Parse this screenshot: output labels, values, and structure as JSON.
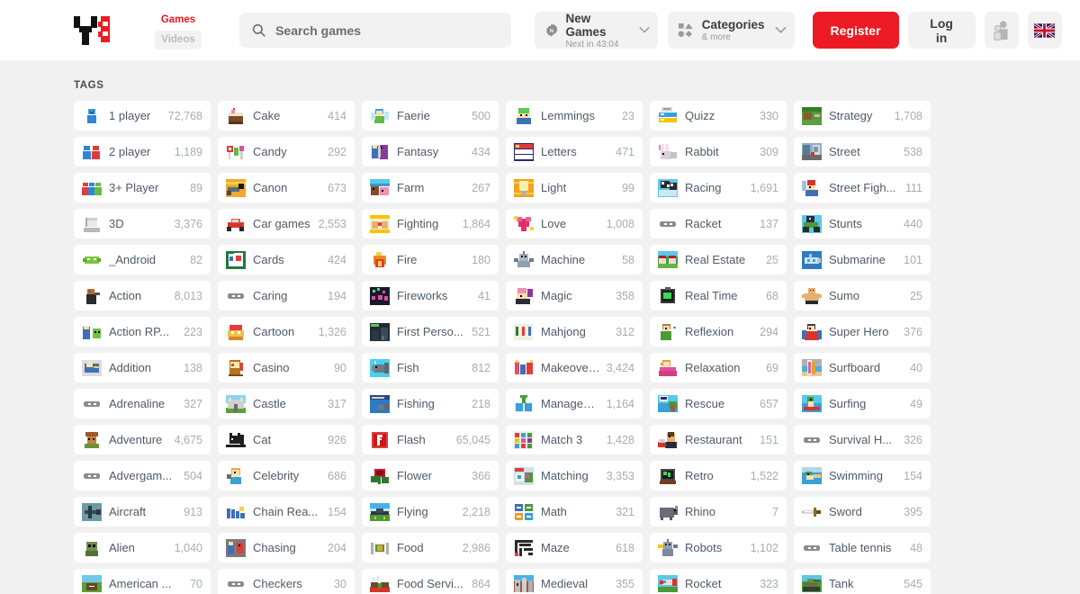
{
  "header": {
    "logo_name": "y8-logo",
    "mode_games": "Games",
    "mode_videos": "Videos",
    "search_placeholder": "Search games",
    "search_value": "",
    "new_games_title": "New Games",
    "new_games_sub": "Next in 43:04",
    "categories_title": "Categories",
    "categories_sub": "& more",
    "register_label": "Register",
    "login_label": "Log in",
    "avatar_icon": "user-silhouette-icon",
    "flag_icon": "uk-flag-icon",
    "brand_red": "#ec1b23",
    "chip_grey": "#f2f2f2"
  },
  "main": {
    "tags_heading": "TAGS",
    "columns": 6,
    "tags": [
      {
        "label": "1 player",
        "count": "72,768",
        "icon": "one-player-icon"
      },
      {
        "label": "Cake",
        "count": "414",
        "icon": "cake-icon"
      },
      {
        "label": "Faerie",
        "count": "500",
        "icon": "faerie-icon"
      },
      {
        "label": "Lemmings",
        "count": "23",
        "icon": "lemmings-icon"
      },
      {
        "label": "Quizz",
        "count": "330",
        "icon": "quizz-icon"
      },
      {
        "label": "Strategy",
        "count": "1,708",
        "icon": "strategy-icon"
      },
      {
        "label": "2 player",
        "count": "1,189",
        "icon": "two-player-icon"
      },
      {
        "label": "Candy",
        "count": "292",
        "icon": "candy-icon"
      },
      {
        "label": "Fantasy",
        "count": "434",
        "icon": "fantasy-icon"
      },
      {
        "label": "Letters",
        "count": "471",
        "icon": "letters-icon"
      },
      {
        "label": "Rabbit",
        "count": "309",
        "icon": "rabbit-icon"
      },
      {
        "label": "Street",
        "count": "538",
        "icon": "street-icon"
      },
      {
        "label": "3+ Player",
        "count": "89",
        "icon": "three-plus-player-icon"
      },
      {
        "label": "Canon",
        "count": "673",
        "icon": "canon-icon"
      },
      {
        "label": "Farm",
        "count": "267",
        "icon": "farm-icon"
      },
      {
        "label": "Light",
        "count": "99",
        "icon": "light-icon"
      },
      {
        "label": "Racing",
        "count": "1,691",
        "icon": "racing-icon"
      },
      {
        "label": "Street Figh...",
        "count": "111",
        "icon": "street-fighting-icon"
      },
      {
        "label": "3D",
        "count": "3,376",
        "icon": "three-d-icon"
      },
      {
        "label": "Car games",
        "count": "2,553",
        "icon": "car-games-icon"
      },
      {
        "label": "Fighting",
        "count": "1,864",
        "icon": "fighting-icon"
      },
      {
        "label": "Love",
        "count": "1,008",
        "icon": "love-icon"
      },
      {
        "label": "Racket",
        "count": "137",
        "icon": "gamepad-icon"
      },
      {
        "label": "Stunts",
        "count": "440",
        "icon": "stunts-icon"
      },
      {
        "label": "_Android",
        "count": "82",
        "icon": "android-icon"
      },
      {
        "label": "Cards",
        "count": "424",
        "icon": "cards-icon"
      },
      {
        "label": "Fire",
        "count": "180",
        "icon": "fire-icon"
      },
      {
        "label": "Machine",
        "count": "58",
        "icon": "machine-icon"
      },
      {
        "label": "Real Estate",
        "count": "25",
        "icon": "real-estate-icon"
      },
      {
        "label": "Submarine",
        "count": "101",
        "icon": "submarine-icon"
      },
      {
        "label": "Action",
        "count": "8,013",
        "icon": "action-icon"
      },
      {
        "label": "Caring",
        "count": "194",
        "icon": "gamepad-icon"
      },
      {
        "label": "Fireworks",
        "count": "41",
        "icon": "fireworks-icon"
      },
      {
        "label": "Magic",
        "count": "358",
        "icon": "magic-icon"
      },
      {
        "label": "Real Time",
        "count": "68",
        "icon": "real-time-icon"
      },
      {
        "label": "Sumo",
        "count": "25",
        "icon": "sumo-icon"
      },
      {
        "label": "Action RP...",
        "count": "223",
        "icon": "action-rpg-icon"
      },
      {
        "label": "Cartoon",
        "count": "1,326",
        "icon": "cartoon-icon"
      },
      {
        "label": "First Perso...",
        "count": "521",
        "icon": "first-person-icon"
      },
      {
        "label": "Mahjong",
        "count": "312",
        "icon": "mahjong-icon"
      },
      {
        "label": "Reflexion",
        "count": "294",
        "icon": "reflexion-icon"
      },
      {
        "label": "Super Hero",
        "count": "376",
        "icon": "super-hero-icon"
      },
      {
        "label": "Addition",
        "count": "138",
        "icon": "addition-icon"
      },
      {
        "label": "Casino",
        "count": "90",
        "icon": "casino-icon"
      },
      {
        "label": "Fish",
        "count": "812",
        "icon": "fish-icon"
      },
      {
        "label": "Makeover ...",
        "count": "3,424",
        "icon": "makeover-icon"
      },
      {
        "label": "Relaxation",
        "count": "69",
        "icon": "relaxation-icon"
      },
      {
        "label": "Surfboard",
        "count": "40",
        "icon": "surfboard-icon"
      },
      {
        "label": "Adrenaline",
        "count": "327",
        "icon": "gamepad-icon"
      },
      {
        "label": "Castle",
        "count": "317",
        "icon": "castle-icon"
      },
      {
        "label": "Fishing",
        "count": "218",
        "icon": "fishing-icon"
      },
      {
        "label": "Managem...",
        "count": "1,164",
        "icon": "management-icon"
      },
      {
        "label": "Rescue",
        "count": "657",
        "icon": "rescue-icon"
      },
      {
        "label": "Surfing",
        "count": "49",
        "icon": "surfing-icon"
      },
      {
        "label": "Adventure",
        "count": "4,675",
        "icon": "adventure-icon"
      },
      {
        "label": "Cat",
        "count": "926",
        "icon": "cat-icon"
      },
      {
        "label": "Flash",
        "count": "65,045",
        "icon": "flash-icon"
      },
      {
        "label": "Match 3",
        "count": "1,428",
        "icon": "match-three-icon"
      },
      {
        "label": "Restaurant",
        "count": "151",
        "icon": "restaurant-icon"
      },
      {
        "label": "Survival H...",
        "count": "326",
        "icon": "gamepad-icon"
      },
      {
        "label": "Advergam...",
        "count": "504",
        "icon": "gamepad-icon"
      },
      {
        "label": "Celebrity",
        "count": "686",
        "icon": "celebrity-icon"
      },
      {
        "label": "Flower",
        "count": "366",
        "icon": "flower-icon"
      },
      {
        "label": "Matching",
        "count": "3,353",
        "icon": "matching-icon"
      },
      {
        "label": "Retro",
        "count": "1,522",
        "icon": "retro-icon"
      },
      {
        "label": "Swimming",
        "count": "154",
        "icon": "swimming-icon"
      },
      {
        "label": "Aircraft",
        "count": "913",
        "icon": "aircraft-icon"
      },
      {
        "label": "Chain Rea...",
        "count": "154",
        "icon": "chain-reaction-icon"
      },
      {
        "label": "Flying",
        "count": "2,218",
        "icon": "flying-icon"
      },
      {
        "label": "Math",
        "count": "321",
        "icon": "math-icon"
      },
      {
        "label": "Rhino",
        "count": "7",
        "icon": "rhino-icon"
      },
      {
        "label": "Sword",
        "count": "395",
        "icon": "sword-icon"
      },
      {
        "label": "Alien",
        "count": "1,040",
        "icon": "alien-icon"
      },
      {
        "label": "Chasing",
        "count": "204",
        "icon": "chasing-icon"
      },
      {
        "label": "Food",
        "count": "2,986",
        "icon": "food-icon"
      },
      {
        "label": "Maze",
        "count": "618",
        "icon": "maze-icon"
      },
      {
        "label": "Robots",
        "count": "1,102",
        "icon": "robots-icon"
      },
      {
        "label": "Table tennis",
        "count": "48",
        "icon": "gamepad-icon"
      },
      {
        "label": "American ...",
        "count": "70",
        "icon": "american-football-icon"
      },
      {
        "label": "Checkers",
        "count": "30",
        "icon": "gamepad-icon"
      },
      {
        "label": "Food Servi...",
        "count": "864",
        "icon": "food-service-icon"
      },
      {
        "label": "Medieval",
        "count": "355",
        "icon": "medieval-icon"
      },
      {
        "label": "Rocket",
        "count": "323",
        "icon": "rocket-icon"
      },
      {
        "label": "Tank",
        "count": "545",
        "icon": "tank-icon"
      }
    ]
  }
}
